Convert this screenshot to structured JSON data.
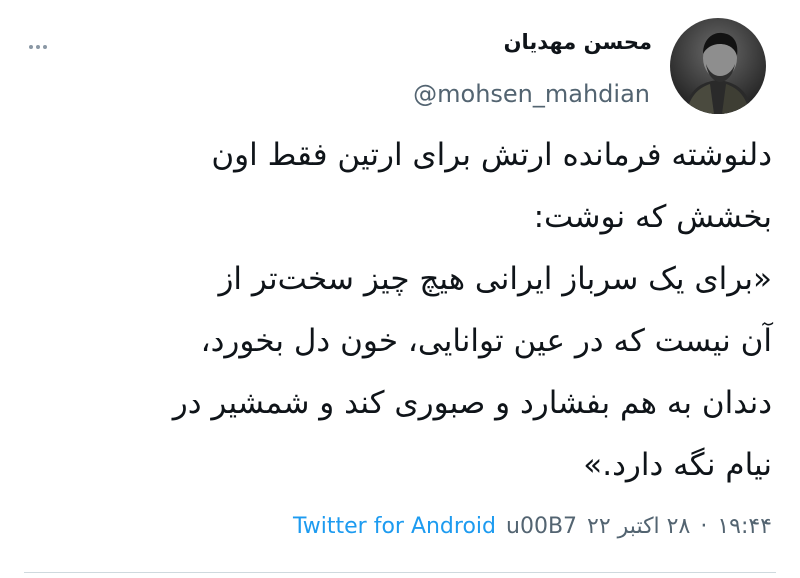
{
  "author": {
    "display_name": "محسن مهدیان",
    "handle": "@mohsen_mahdian"
  },
  "tweet": {
    "lines": [
      "دلنوشته فرمانده ارتش برای ارتین فقط اون",
      "بخشش که نوشت:",
      "«برای یک سرباز ایرانی هیچ چیز سخت‌تر از",
      "آن نیست که در عین توانایی، خون دل بخورد،",
      "دندان به هم بفشارد و صبوری کند و شمشیر در",
      "نیام نگه دارد.»"
    ]
  },
  "meta": {
    "time": "۱۹:۴۴",
    "separator": "·",
    "date": "۲۸ اکتبر ۲۲",
    "code": "u00B7",
    "source": "Twitter for Android"
  },
  "colors": {
    "text": "#0f1419",
    "secondary": "#536471",
    "link": "#1d9bf0"
  },
  "icons": {
    "more": "more-options-icon"
  }
}
